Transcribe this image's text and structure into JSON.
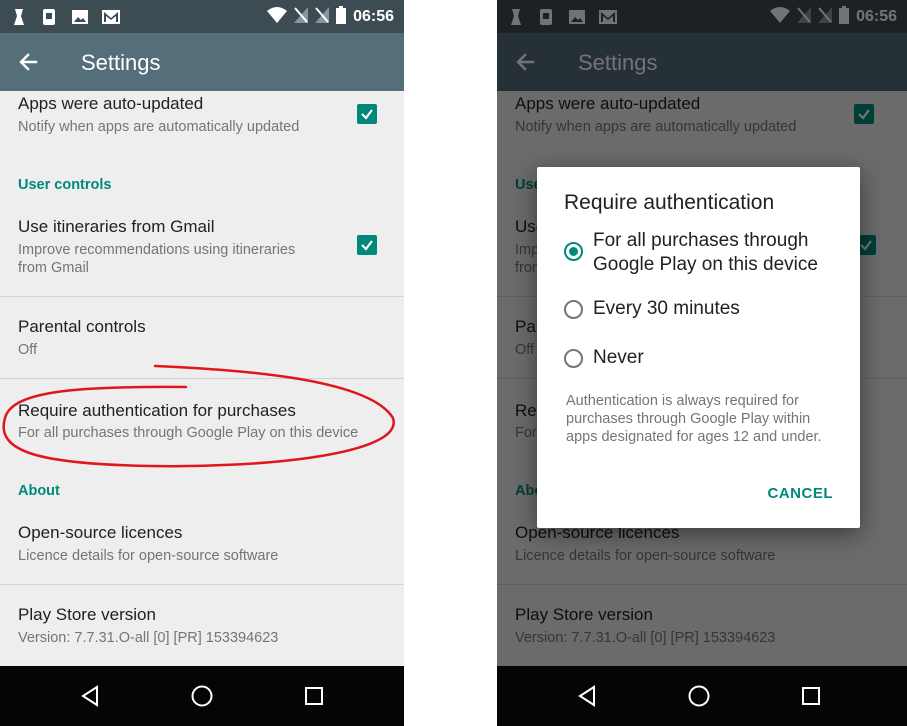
{
  "status_bar": {
    "time": "06:56"
  },
  "app_bar": {
    "title": "Settings"
  },
  "settings": {
    "auto_updated": {
      "title": "Apps were auto-updated",
      "subtitle": "Notify when apps are automatically updated",
      "checked": true
    },
    "user_controls_header": "User controls",
    "itineraries": {
      "title": "Use itineraries from Gmail",
      "subtitle_line1": "Improve recommendations using itineraries",
      "subtitle_line2": "from Gmail",
      "checked": true
    },
    "parental": {
      "title": "Parental controls",
      "subtitle": "Off"
    },
    "auth": {
      "title": "Require authentication for purchases",
      "subtitle": "For all purchases through Google Play on this device"
    },
    "about_header": "About",
    "licences": {
      "title": "Open-source licences",
      "subtitle": "Licence details for open-source software"
    },
    "version": {
      "title": "Play Store version",
      "subtitle": "Version: 7.7.31.O-all [0] [PR] 153394623"
    }
  },
  "dialog": {
    "title": "Require authentication",
    "options": [
      {
        "line1": "For all purchases through",
        "line2": "Google Play on this device",
        "selected": true
      },
      {
        "line1": "Every 30 minutes",
        "selected": false
      },
      {
        "line1": "Never",
        "selected": false
      }
    ],
    "note": "Authentication is always required for purchases through Google Play within apps designated for ages 12 and under.",
    "cancel_label": "CANCEL"
  },
  "colors": {
    "accent": "#00897b",
    "app_bar": "#546e7a",
    "status_bar": "#3d4b53",
    "annotation": "#e0151d"
  }
}
